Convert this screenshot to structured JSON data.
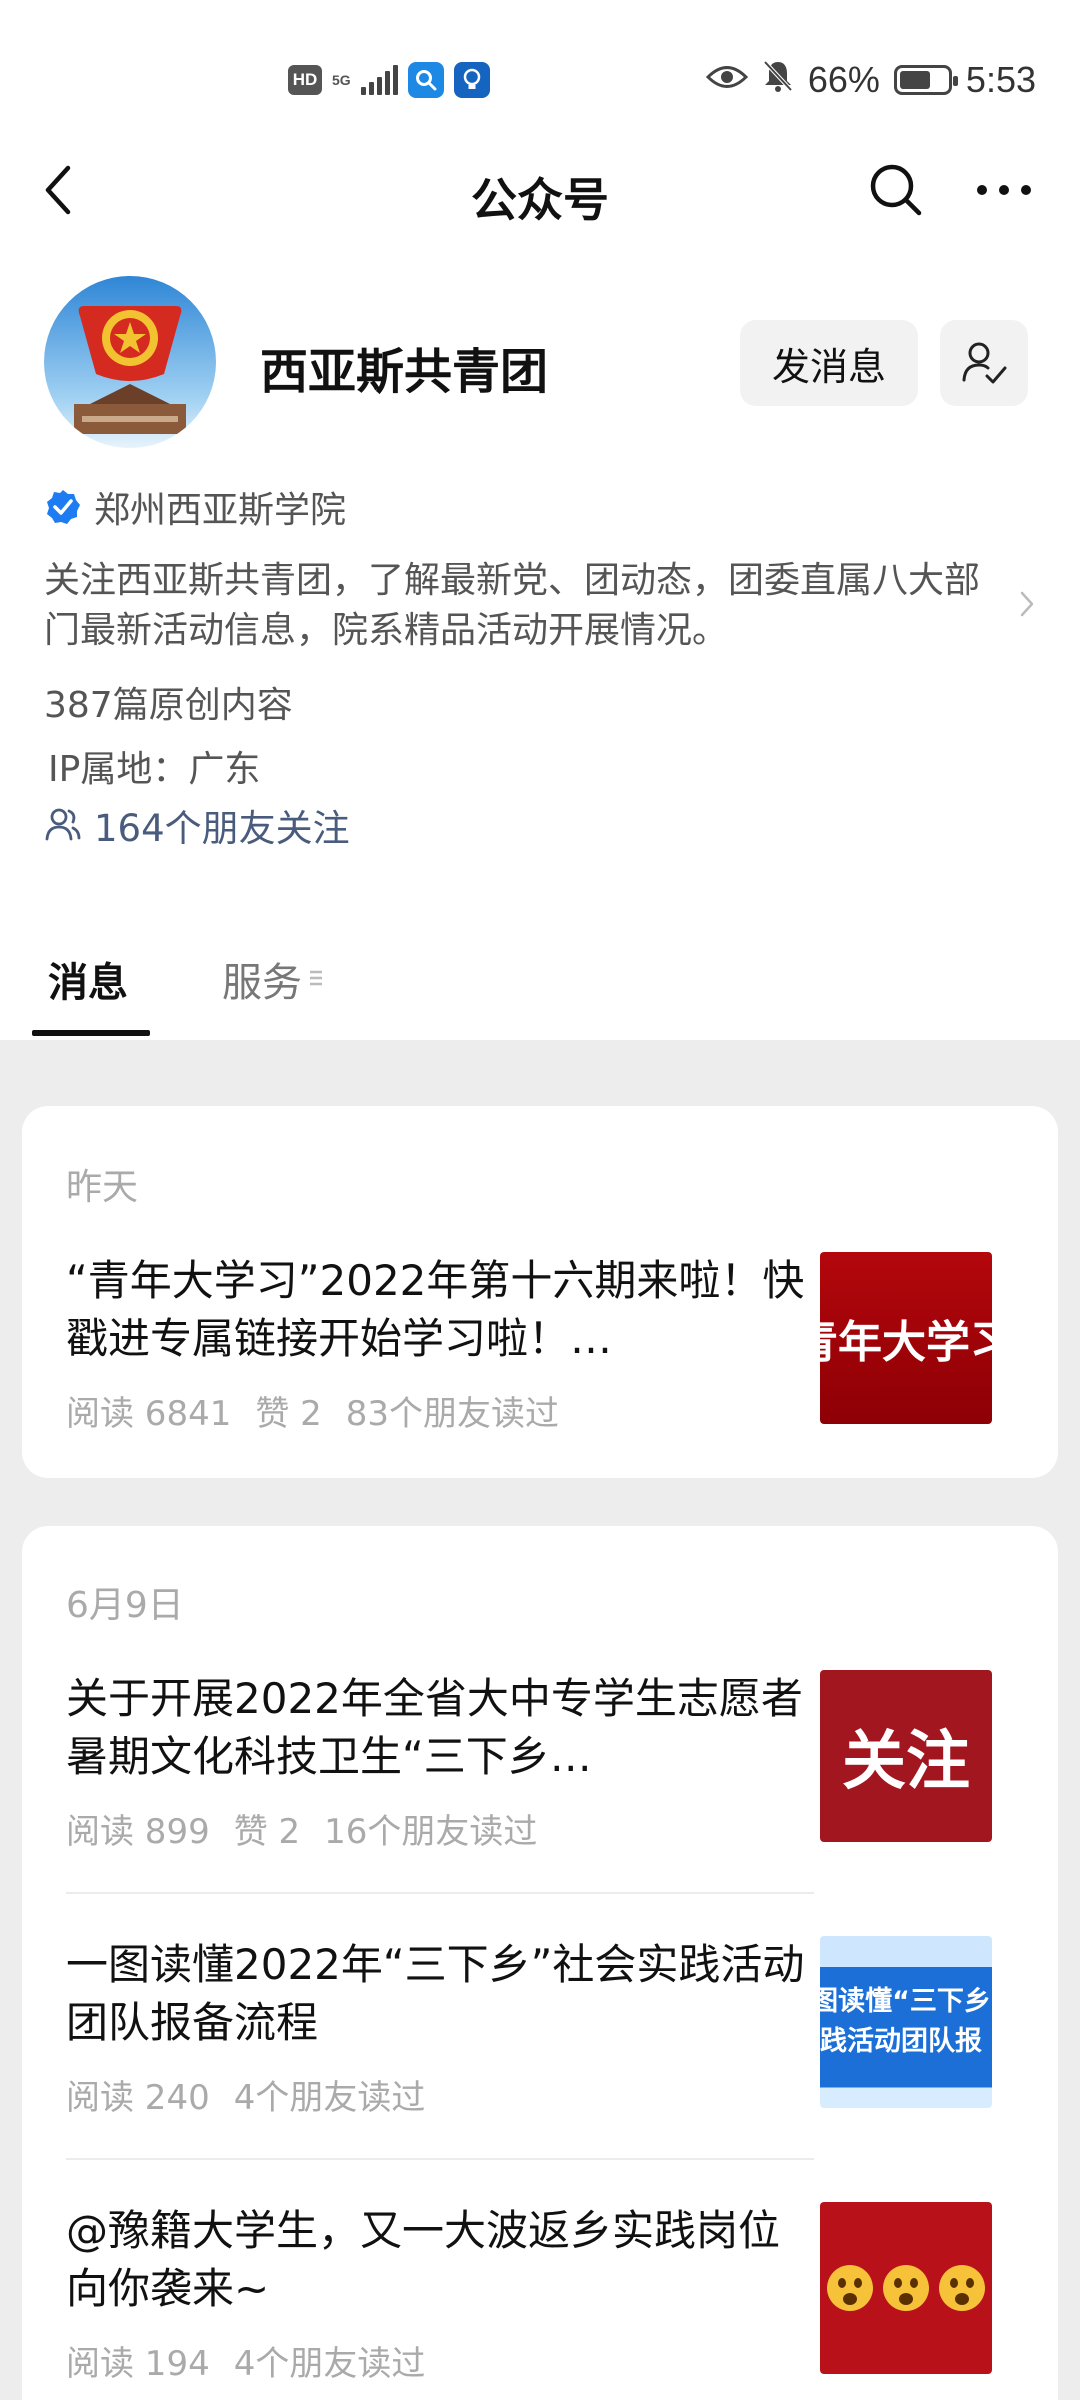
{
  "status_bar": {
    "hd": "HD",
    "network": "5G",
    "battery_percent": "66%",
    "battery_level": 0.66,
    "time": "5:53",
    "icons": [
      "hd-icon",
      "signal-icon",
      "search-app-icon",
      "bulb-app-icon",
      "eye-icon",
      "bell-off-icon",
      "battery-icon"
    ]
  },
  "nav": {
    "title": "公众号",
    "icons": [
      "back-arrow-icon",
      "search-icon",
      "more-icon"
    ]
  },
  "profile": {
    "name": "西亚斯共青团",
    "message_button": "发消息",
    "verified_org": "郑州西亚斯学院",
    "description": "关注西亚斯共青团，了解最新党、团动态，团委直属八大部门最新活动信息，院系精品活动开展情况。",
    "original_count": "387篇原创内容",
    "ip_location": "IP属地：广东",
    "friends_following": "164个朋友关注",
    "avatar_colors": {
      "sky": "#3a8fd9",
      "flag": "#d42a1f",
      "emblem": "#f2c230"
    }
  },
  "tabs": {
    "messages": "消息",
    "services": "服务"
  },
  "feed": {
    "groups": [
      {
        "date": "昨天",
        "articles": [
          {
            "title": "“青年大学习”2022年第十六期来啦！快戳进专属链接开始学习啦！…",
            "reads": "阅读 6841",
            "likes": "赞 2",
            "friends": "83个朋友读过",
            "thumb_text": "青年大学习"
          }
        ]
      },
      {
        "date": "6月9日",
        "articles": [
          {
            "title": "关于开展2022年全省大中专学生志愿者暑期文化科技卫生“三下乡…",
            "reads": "阅读 899",
            "likes": "赞 2",
            "friends": "16个朋友读过",
            "thumb_text": "关注"
          },
          {
            "title": "一图读懂2022年“三下乡”社会实践活动团队报备流程",
            "reads": "阅读 240",
            "friends": "4个朋友读过",
            "thumb_line1": "图读懂“三下乡",
            "thumb_line2": "践活动团队报"
          },
          {
            "title": "@豫籍大学生，又一大波返乡实践岗位向你袭来~",
            "reads": "阅读 194",
            "friends": "4个朋友读过"
          }
        ]
      }
    ]
  }
}
